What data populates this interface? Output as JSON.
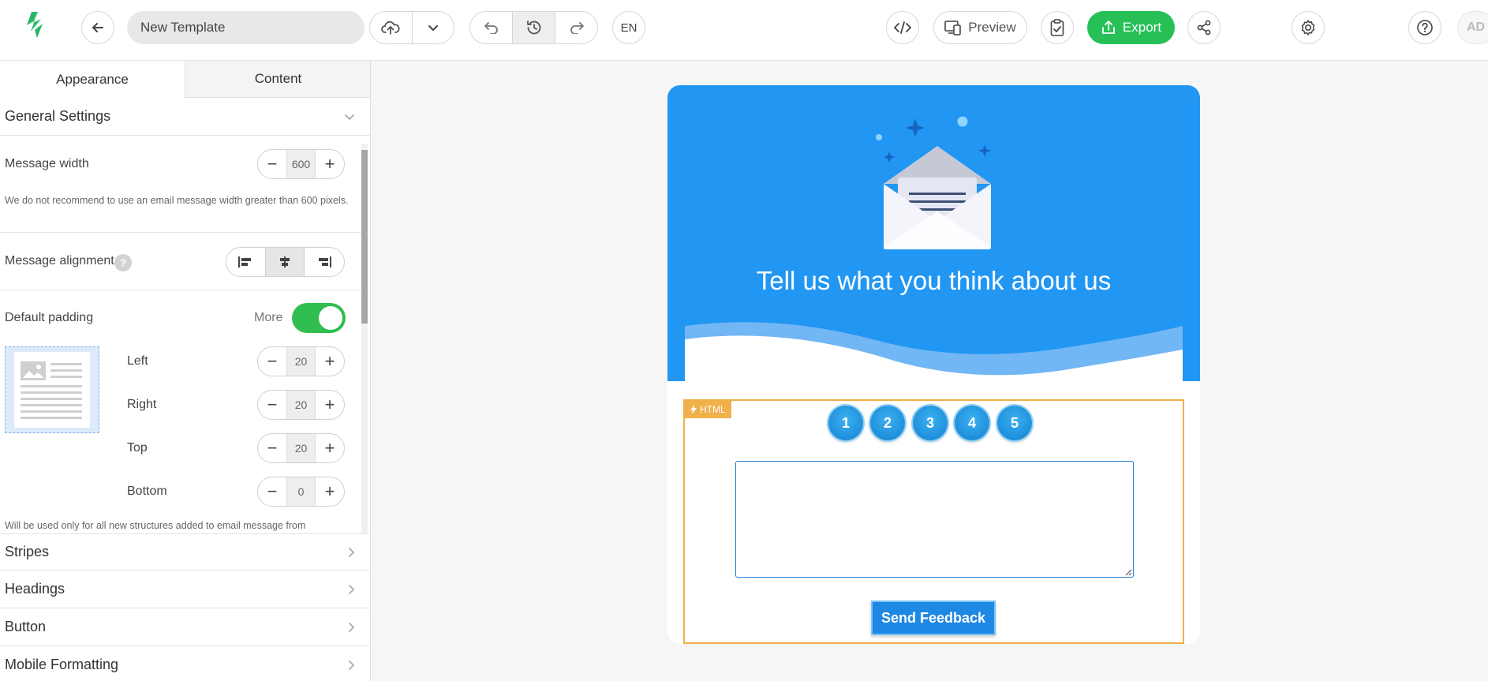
{
  "toolbar": {
    "template_name": "New Template",
    "language": "EN",
    "preview_label": "Preview",
    "export_label": "Export",
    "user_initials": "AD"
  },
  "tabs": [
    {
      "label": "Appearance",
      "active": true
    },
    {
      "label": "Content",
      "active": false
    }
  ],
  "general_settings": {
    "title": "General Settings",
    "message_width_label": "Message width",
    "message_width": "600",
    "width_note": "We do not recommend to use an email message width greater than 600 pixels.",
    "alignment_label": "Message alignment",
    "alignment_help": "?",
    "alignment_selected": "center",
    "default_padding_label": "Default padding",
    "more_label": "More",
    "padding_enabled": true,
    "padding": [
      {
        "label": "Left",
        "value": "20"
      },
      {
        "label": "Right",
        "value": "20"
      },
      {
        "label": "Top",
        "value": "20"
      },
      {
        "label": "Bottom",
        "value": "0"
      }
    ],
    "padding_note": "Will be used only for all new structures added to email message from"
  },
  "sections": [
    "Stripes",
    "Headings",
    "Button",
    "Mobile Formatting"
  ],
  "email": {
    "hero_title": "Tell us what you think about us",
    "block_badge": "HTML",
    "ratings": [
      "1",
      "2",
      "3",
      "4",
      "5"
    ],
    "send_button": "Send Feedback"
  },
  "colors": {
    "accent_blue": "#2196f3",
    "export_green": "#27c057",
    "toggle_green": "#2fbe4f",
    "html_block_orange": "#f0b04a"
  }
}
